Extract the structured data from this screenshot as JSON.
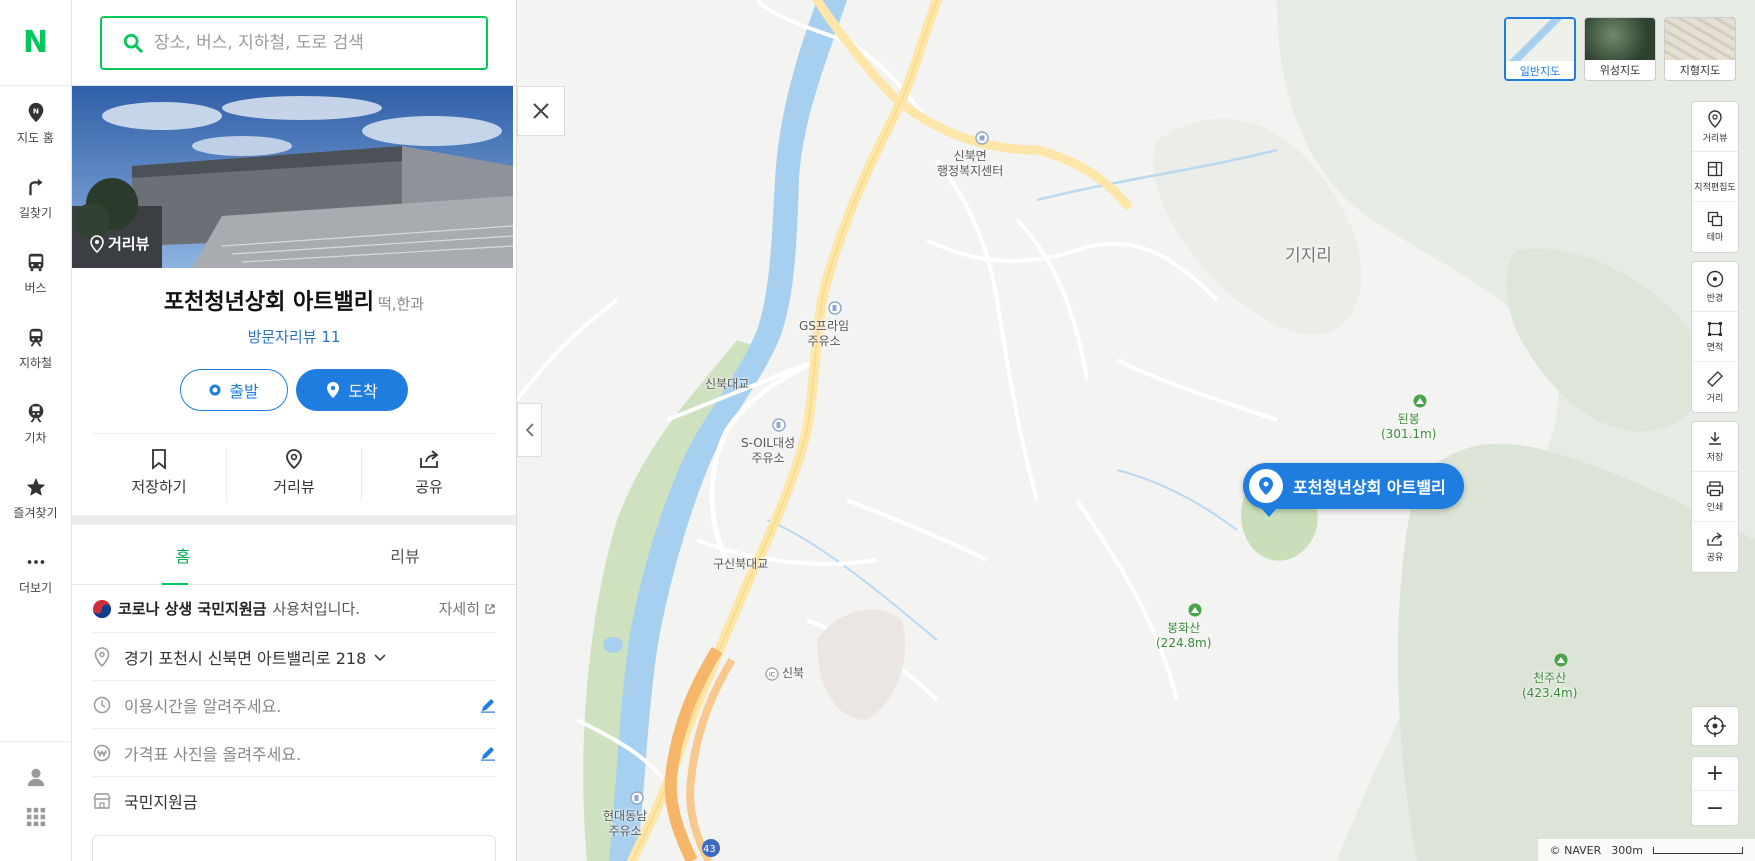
{
  "nav": {
    "logo": "N",
    "items": [
      {
        "label": "지도 홈",
        "icon": "map-home-icon"
      },
      {
        "label": "길찾기",
        "icon": "directions-icon"
      },
      {
        "label": "버스",
        "icon": "bus-icon"
      },
      {
        "label": "지하철",
        "icon": "subway-icon"
      },
      {
        "label": "기차",
        "icon": "train-icon"
      },
      {
        "label": "즐겨찾기",
        "icon": "star-icon"
      },
      {
        "label": "더보기",
        "icon": "more-icon"
      }
    ]
  },
  "search": {
    "placeholder": "장소, 버스, 지하철, 도로 검색"
  },
  "place": {
    "photo_label": "거리뷰",
    "title": "포천청년상회 아트밸리",
    "category": "떡,한과",
    "review": "방문자리뷰 11",
    "start_label": "출발",
    "arrive_label": "도착",
    "actions": {
      "save": "저장하기",
      "streetview": "거리뷰",
      "share": "공유"
    },
    "tabs": {
      "home": "홈",
      "review": "리뷰"
    },
    "notice": {
      "title": "코로나 상생 국민지원금",
      "text": "사용처입니다.",
      "more": "자세히"
    },
    "address": "경기 포천시 신북면 아트밸리로 218",
    "hours_prompt": "이용시간을 알려주세요.",
    "price_prompt": "가격표 사진을 올려주세요.",
    "tag": "국민지원금"
  },
  "map": {
    "labels": {
      "sinbuk_office": "신북면\n행정복지센터",
      "gijiri": "기지리",
      "gs": "GS프라임\n주유소",
      "sinbuk_bridge": "신북대교",
      "soil": "S-OIL대성\n주유소",
      "gusinbuk": "구신북대교",
      "ic": "신북",
      "hyundai": "현대동남\n주유소",
      "route": "43"
    },
    "peaks": {
      "doenbong": "된봉\n(301.1m)",
      "bonghwasan": "봉화산\n(224.8m)",
      "cheonjusan": "천주산\n(423.4m)"
    },
    "pin_label": "포천청년상회 아트밸리",
    "map_types": {
      "normal": "일반지도",
      "satellite": "위성지도",
      "terrain": "지형지도"
    },
    "tools": {
      "streetview": "거리뷰",
      "cadastral": "지적편집도",
      "theme": "테마",
      "radius": "반경",
      "area": "면적",
      "distance": "거리",
      "save": "저장",
      "print": "인쇄",
      "share": "공유"
    },
    "zoom_in": "+",
    "zoom_out": "−",
    "copyright": "© NAVER",
    "scale": "300m"
  },
  "colors": {
    "brand_green": "#03c75a",
    "accent_blue": "#1f7de0",
    "river": "#a7d0f0",
    "road": "#fde6a8"
  }
}
